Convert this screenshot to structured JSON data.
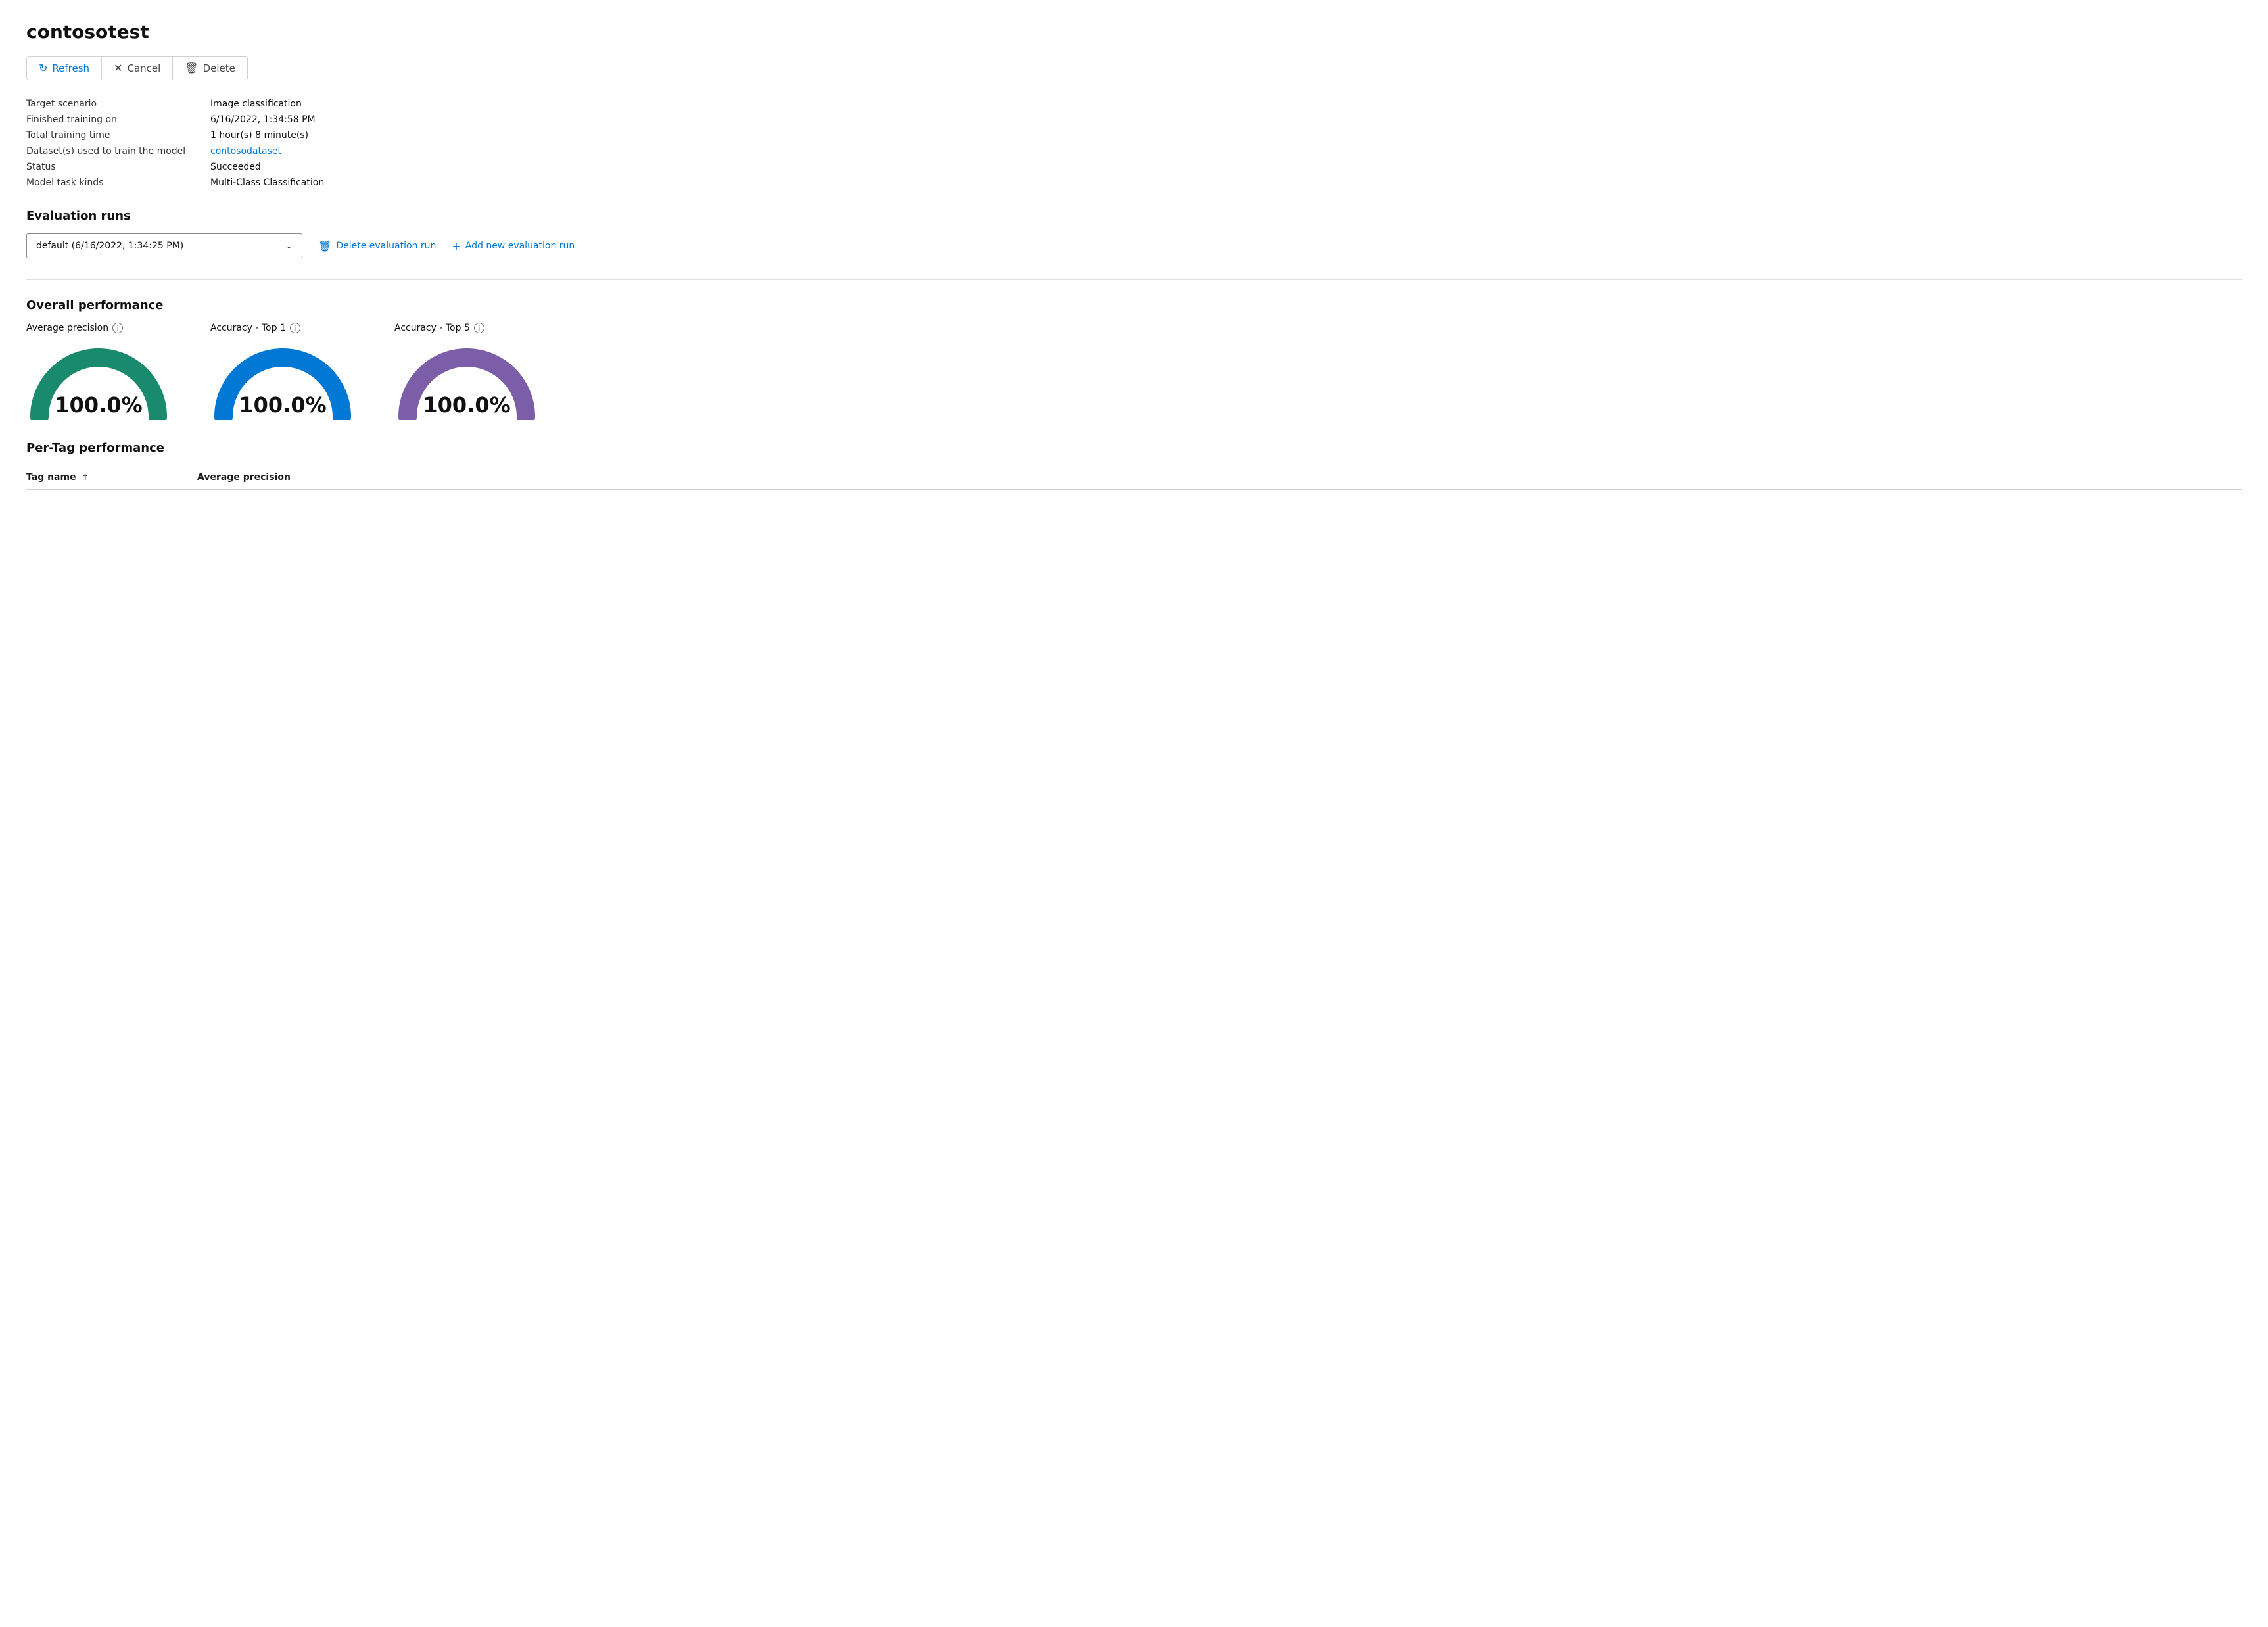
{
  "page": {
    "title": "contosotest",
    "toolbar": {
      "refresh_label": "Refresh",
      "cancel_label": "Cancel",
      "delete_label": "Delete"
    },
    "info": {
      "target_scenario_label": "Target scenario",
      "target_scenario_value": "Image classification",
      "finished_training_label": "Finished training on",
      "finished_training_value": "6/16/2022, 1:34:58 PM",
      "total_training_label": "Total training time",
      "total_training_value": "1 hour(s) 8 minute(s)",
      "datasets_label": "Dataset(s) used to train the model",
      "datasets_value": "contosodataset",
      "status_label": "Status",
      "status_value": "Succeeded",
      "model_task_label": "Model task kinds",
      "model_task_value": "Multi-Class Classification"
    },
    "evaluation_runs": {
      "section_title": "Evaluation runs",
      "dropdown_value": "default (6/16/2022, 1:34:25 PM)",
      "delete_eval_label": "Delete evaluation run",
      "add_eval_label": "Add new evaluation run"
    },
    "overall_performance": {
      "section_title": "Overall performance",
      "gauges": [
        {
          "label": "Average precision",
          "value": "100.0%",
          "color": "#1a8a6e",
          "id": "avg-precision"
        },
        {
          "label": "Accuracy - Top 1",
          "value": "100.0%",
          "color": "#0078d4",
          "id": "accuracy-top1"
        },
        {
          "label": "Accuracy - Top 5",
          "value": "100.0%",
          "color": "#7b5ea7",
          "id": "accuracy-top5"
        }
      ]
    },
    "per_tag_performance": {
      "section_title": "Per-Tag performance",
      "columns": [
        {
          "label": "Tag name",
          "sortable": true,
          "sort_dir": "asc"
        },
        {
          "label": "Average precision",
          "sortable": false
        }
      ]
    }
  }
}
